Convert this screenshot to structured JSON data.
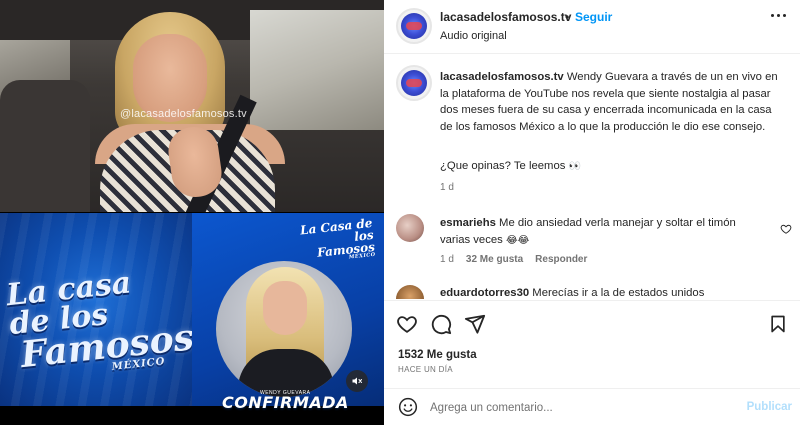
{
  "media": {
    "watermark": "@lacasadelosfamosos.tv",
    "logo_big": {
      "line1": "La casa de los",
      "line2": "Famosos",
      "line3": "MÉXICO"
    },
    "logo_small": {
      "line1": "La Casa de los",
      "line2": "Famosos",
      "line3": "MÉXICO"
    },
    "guest_name": "WENDY GUEVARA",
    "confirmed_label": "CONFIRMADA",
    "mute_icon": "speaker-muted-icon"
  },
  "header": {
    "username": "lacasadelosfamosos.tv",
    "separator": "•",
    "follow_label": "Seguir",
    "audio_label": "Audio original",
    "more_icon": "more-options-icon"
  },
  "caption": {
    "username": "lacasadelosfamosos.tv",
    "text": "Wendy Guevara a través de un en vivo en la plataforma de YouTube nos revela que siente nostalgia al pasar dos meses fuera de su casa y encerrada incomunicada en la casa de los famosos México a lo que la producción le dio ese consejo.",
    "question": "¿Que opinas? Te leemos",
    "question_emoji": "👀",
    "time": "1 d"
  },
  "comments": [
    {
      "username": "esmariehs",
      "text": "Me dio ansiedad verla manejar y soltar el timón varias veces",
      "emoji": "😂😂",
      "time": "1 d",
      "likes": "32 Me gusta",
      "reply_label": "Responder"
    },
    {
      "username": "eduardotorres30",
      "text": "Merecías ir a la de estados unidos"
    }
  ],
  "actions": {
    "like_icon": "heart-icon",
    "comment_icon": "comment-icon",
    "share_icon": "share-icon",
    "save_icon": "bookmark-icon",
    "likes_count": "1532 Me gusta",
    "date": "HACE UN DÍA"
  },
  "composer": {
    "placeholder": "Agrega un comentario...",
    "publish_label": "Publicar",
    "emoji_icon": "emoji-icon"
  },
  "colors": {
    "link_blue": "#0095f6",
    "publish_disabled": "#b2dffc",
    "secondary_text": "#737373",
    "show_blue": "#0c57cf"
  }
}
